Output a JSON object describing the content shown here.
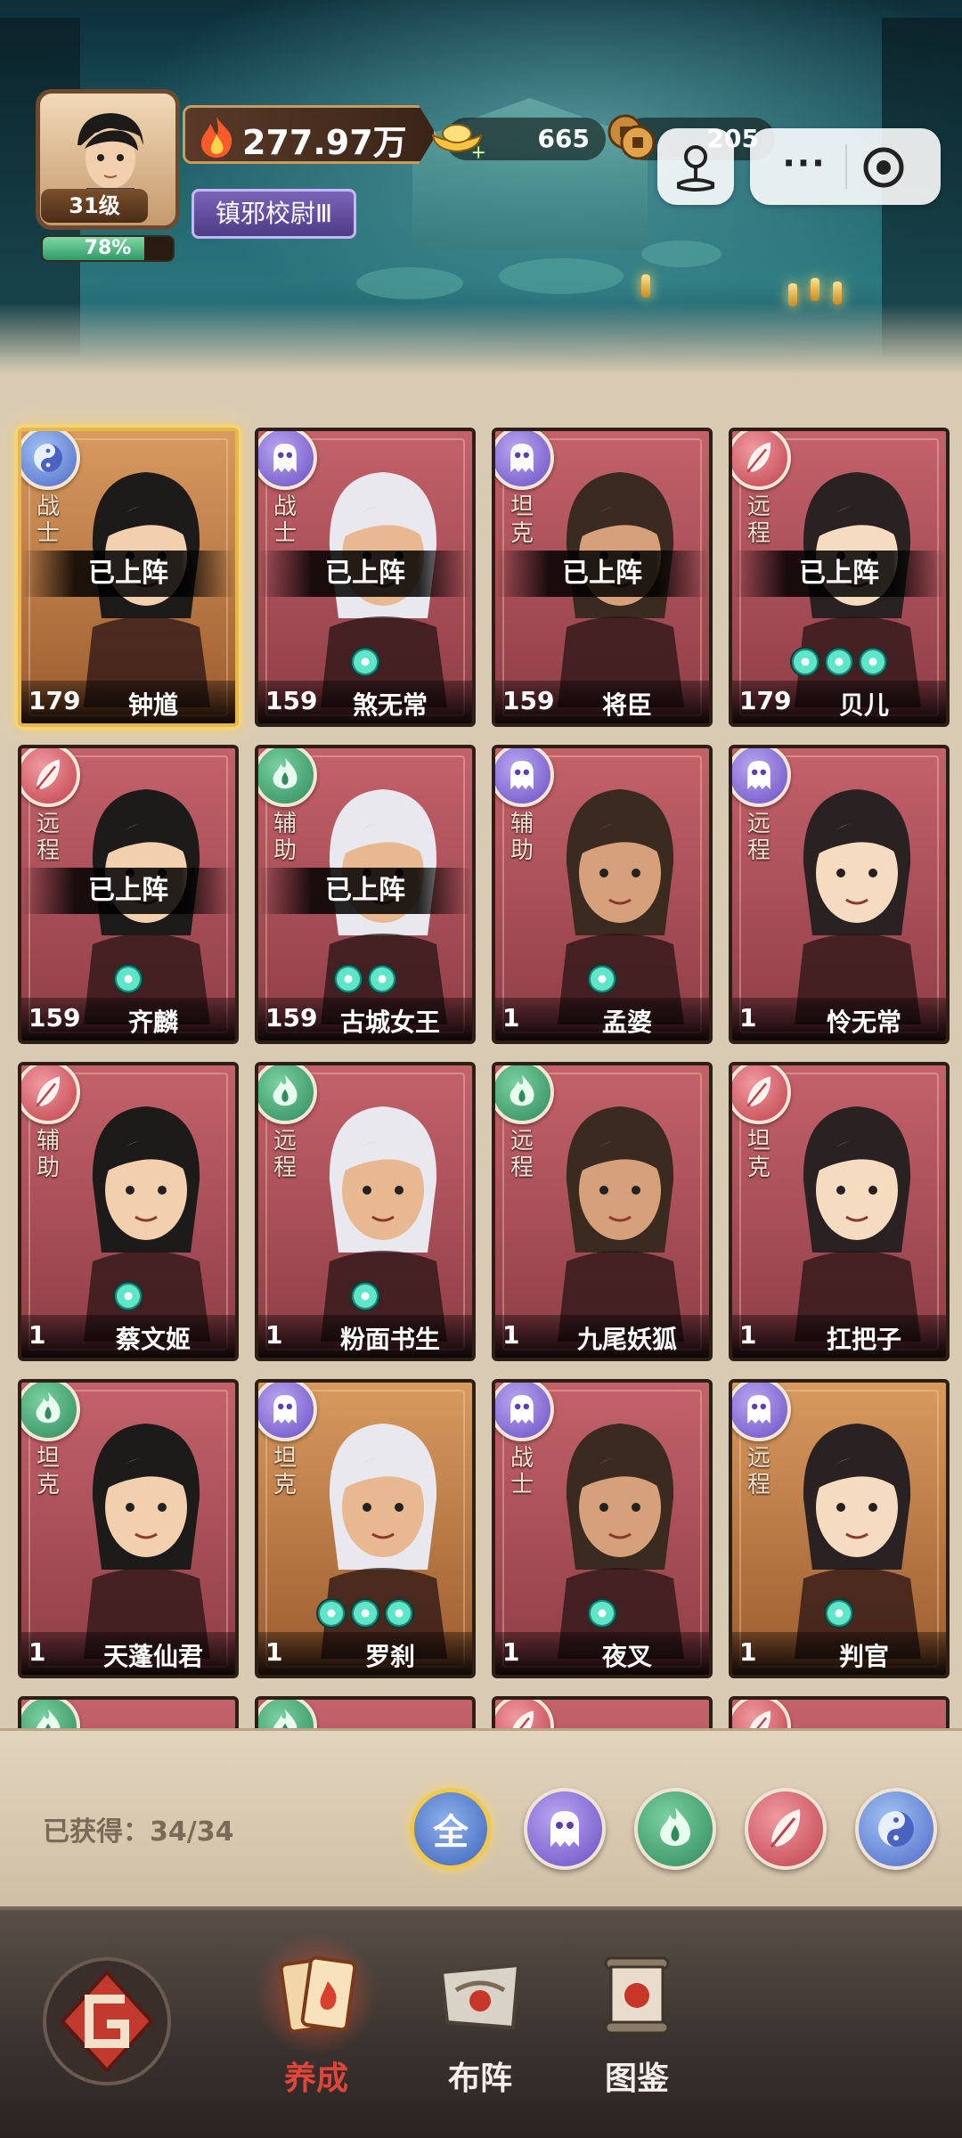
{
  "player": {
    "level_label": "31级",
    "exp_percent": "78%",
    "exp_fraction": 0.78,
    "power": "277.97万",
    "title": "镇邪校尉Ⅲ"
  },
  "currency": {
    "gold_ingot": "665",
    "coins": "205"
  },
  "top_buttons": {
    "more_label": "···"
  },
  "cards": [
    {
      "name": "钟馗",
      "level": "179",
      "role": "战士",
      "element": "yin",
      "deployed": true,
      "deployed_label": "已上阵",
      "stars": 0,
      "selected": true,
      "frame": "orange"
    },
    {
      "name": "煞无常",
      "level": "159",
      "role": "战士",
      "element": "ghost",
      "deployed": true,
      "deployed_label": "已上阵",
      "stars": 1,
      "selected": false,
      "frame": "red"
    },
    {
      "name": "将臣",
      "level": "159",
      "role": "坦克",
      "element": "ghost",
      "deployed": true,
      "deployed_label": "已上阵",
      "stars": 0,
      "selected": false,
      "frame": "red"
    },
    {
      "name": "贝儿",
      "level": "179",
      "role": "远程",
      "element": "fire",
      "deployed": true,
      "deployed_label": "已上阵",
      "stars": 3,
      "selected": false,
      "frame": "red"
    },
    {
      "name": "齐麟",
      "level": "159",
      "role": "远程",
      "element": "fire",
      "deployed": true,
      "deployed_label": "已上阵",
      "stars": 1,
      "selected": false,
      "frame": "red"
    },
    {
      "name": "古城女王",
      "level": "159",
      "role": "辅助",
      "element": "wind",
      "deployed": true,
      "deployed_label": "已上阵",
      "stars": 2,
      "selected": false,
      "frame": "red"
    },
    {
      "name": "孟婆",
      "level": "1",
      "role": "辅助",
      "element": "ghost",
      "deployed": false,
      "deployed_label": "",
      "stars": 1,
      "selected": false,
      "frame": "red"
    },
    {
      "name": "怜无常",
      "level": "1",
      "role": "远程",
      "element": "ghost",
      "deployed": false,
      "deployed_label": "",
      "stars": 0,
      "selected": false,
      "frame": "red"
    },
    {
      "name": "蔡文姬",
      "level": "1",
      "role": "辅助",
      "element": "fire",
      "deployed": false,
      "deployed_label": "",
      "stars": 1,
      "selected": false,
      "frame": "red"
    },
    {
      "name": "粉面书生",
      "level": "1",
      "role": "远程",
      "element": "wind",
      "deployed": false,
      "deployed_label": "",
      "stars": 1,
      "selected": false,
      "frame": "red"
    },
    {
      "name": "九尾妖狐",
      "level": "1",
      "role": "远程",
      "element": "wind",
      "deployed": false,
      "deployed_label": "",
      "stars": 0,
      "selected": false,
      "frame": "red"
    },
    {
      "name": "扛把子",
      "level": "1",
      "role": "坦克",
      "element": "fire",
      "deployed": false,
      "deployed_label": "",
      "stars": 0,
      "selected": false,
      "frame": "red"
    },
    {
      "name": "天蓬仙君",
      "level": "1",
      "role": "坦克",
      "element": "wind",
      "deployed": false,
      "deployed_label": "",
      "stars": 0,
      "selected": false,
      "frame": "red"
    },
    {
      "name": "罗刹",
      "level": "1",
      "role": "坦克",
      "element": "ghost",
      "deployed": false,
      "deployed_label": "",
      "stars": 3,
      "selected": false,
      "frame": "orange"
    },
    {
      "name": "夜叉",
      "level": "1",
      "role": "战士",
      "element": "ghost",
      "deployed": false,
      "deployed_label": "",
      "stars": 1,
      "selected": false,
      "frame": "red"
    },
    {
      "name": "判官",
      "level": "1",
      "role": "远程",
      "element": "ghost",
      "deployed": false,
      "deployed_label": "",
      "stars": 1,
      "selected": false,
      "frame": "orange"
    }
  ],
  "partial_row_elements": [
    "wind",
    "wind",
    "fire",
    "fire"
  ],
  "collection": {
    "count_label": "已获得：34/34"
  },
  "filters": [
    {
      "id": "all",
      "label": "全",
      "icon": "all-filter"
    },
    {
      "id": "ghost",
      "label": "",
      "icon": "ghost-icon"
    },
    {
      "id": "wind",
      "label": "",
      "icon": "wind-flame-icon"
    },
    {
      "id": "fire",
      "label": "",
      "icon": "feather-flame-icon"
    },
    {
      "id": "yin",
      "label": "",
      "icon": "yin-yang-icon"
    }
  ],
  "nav": {
    "items": [
      {
        "label": "养成",
        "icon": "cards-icon",
        "active": true
      },
      {
        "label": "布阵",
        "icon": "formation-icon",
        "active": false
      },
      {
        "label": "图鉴",
        "icon": "scroll-icon",
        "active": false
      }
    ]
  },
  "colors": {
    "accent_active": "#e0453a",
    "card_red": "#c4626a",
    "card_orange": "#d89a5f",
    "star_teal": "#5fe6c8"
  }
}
